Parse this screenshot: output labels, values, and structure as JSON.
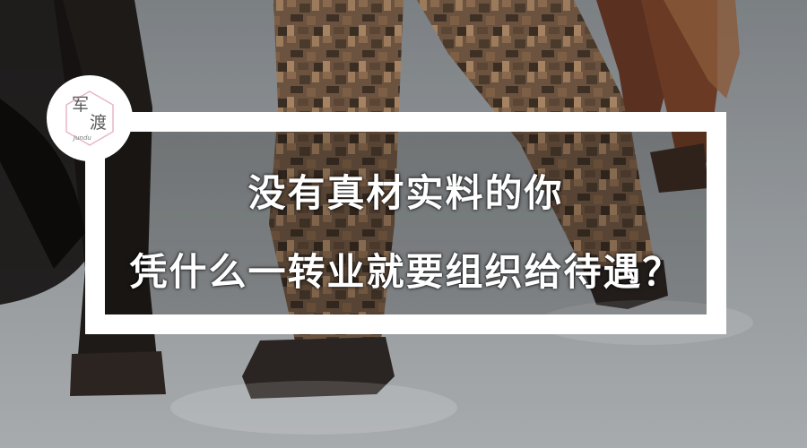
{
  "headline": {
    "line1": "没有真材实料的你",
    "line2": "凭什么一转业就要组织给待遇？"
  },
  "logo": {
    "char1": "军",
    "char2": "渡",
    "subtext": "Jundu"
  },
  "colors": {
    "frame": "#ffffff",
    "logo_hexagon": "#e8b7c6",
    "headline_text": "#ffffff"
  },
  "scene_elements": [
    "horse-leg-left",
    "horse-tail-left",
    "soldier-legs-camouflage",
    "horse-legs-right",
    "snow-ground"
  ]
}
